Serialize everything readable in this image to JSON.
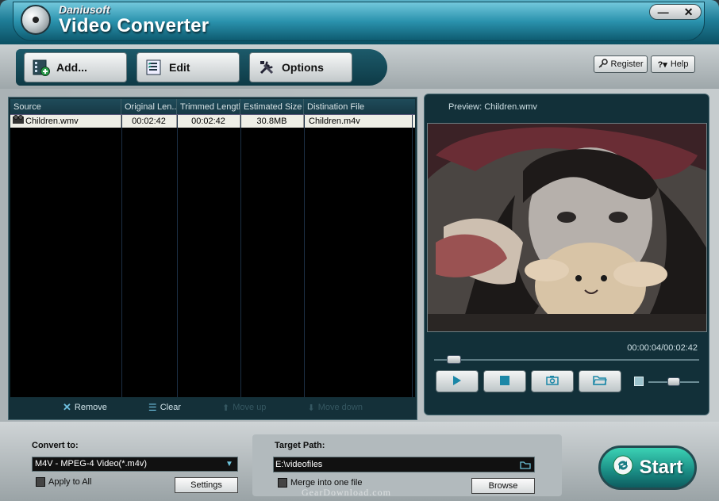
{
  "window": {
    "brand": "Daniusoft",
    "title": "Video Converter",
    "minimize": "—",
    "close": "✕"
  },
  "toolbar": {
    "add_label": "Add...",
    "edit_label": "Edit",
    "options_label": "Options",
    "register_label": "Register",
    "help_label": "Help"
  },
  "file_list": {
    "columns": [
      "Source",
      "Original Len...",
      "Trimmed Length",
      "Estimated Size",
      "Distination File"
    ],
    "rows": [
      {
        "source": "Children.wmv",
        "original_length": "00:02:42",
        "trimmed_length": "00:02:42",
        "estimated_size": "30.8MB",
        "destination": "Children.m4v"
      }
    ],
    "actions": {
      "remove": "Remove",
      "clear": "Clear",
      "move_up": "Move up",
      "move_down": "Move down"
    }
  },
  "preview": {
    "title": "Preview: Children.wmv",
    "time": "00:00:04/00:02:42",
    "seek_fraction": 0.05,
    "volume_fraction": 0.5
  },
  "convert": {
    "label": "Convert to:",
    "format": "M4V - MPEG-4 Video(*.m4v)",
    "apply_all": "Apply to All",
    "settings": "Settings"
  },
  "target": {
    "label": "Target Path:",
    "path": "E:\\videofiles",
    "merge": "Merge into one file",
    "browse": "Browse"
  },
  "start_label": "Start",
  "watermark": "GearDownload.com",
  "colors": {
    "accent": "#1f7e98",
    "panel": "#123039",
    "start": "#1a8c84"
  }
}
